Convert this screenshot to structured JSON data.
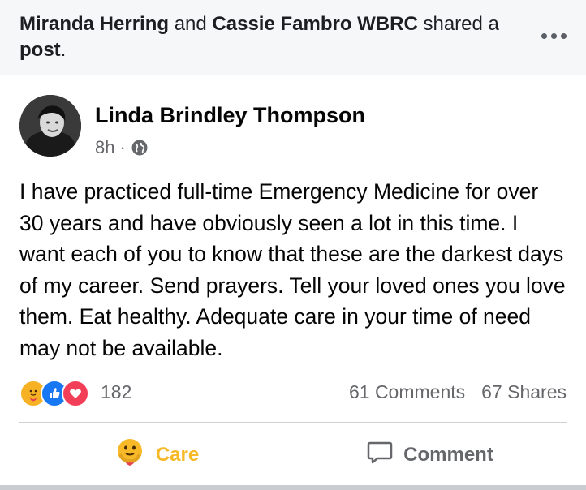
{
  "shared": {
    "user1": "Miranda Herring",
    "and": "and",
    "user2": "Cassie Fambro WBRC",
    "shared_word": "shared",
    "article": "a",
    "object": "post",
    "period": "."
  },
  "post": {
    "author": "Linda Brindley Thompson",
    "time": "8h",
    "separator": "·",
    "privacy_icon": "globe-icon",
    "body": "I have practiced full-time Emergency Medicine for over 30 years and have obviously seen a lot in this time. I want each of you to know that these are the darkest days of my career. Send prayers. Tell your loved ones you love them. Eat healthy. Adequate care in your time of need may not be available."
  },
  "reactions": {
    "icons": [
      "care-reaction-icon",
      "like-reaction-icon",
      "love-reaction-icon"
    ],
    "count": "182",
    "comments": "61 Comments",
    "shares": "67 Shares"
  },
  "actions": {
    "care_label": "Care",
    "comment_label": "Comment"
  },
  "colors": {
    "care": "#f7b928",
    "like": "#1877f2",
    "love": "#f33e58",
    "secondary_text": "#65676b"
  }
}
